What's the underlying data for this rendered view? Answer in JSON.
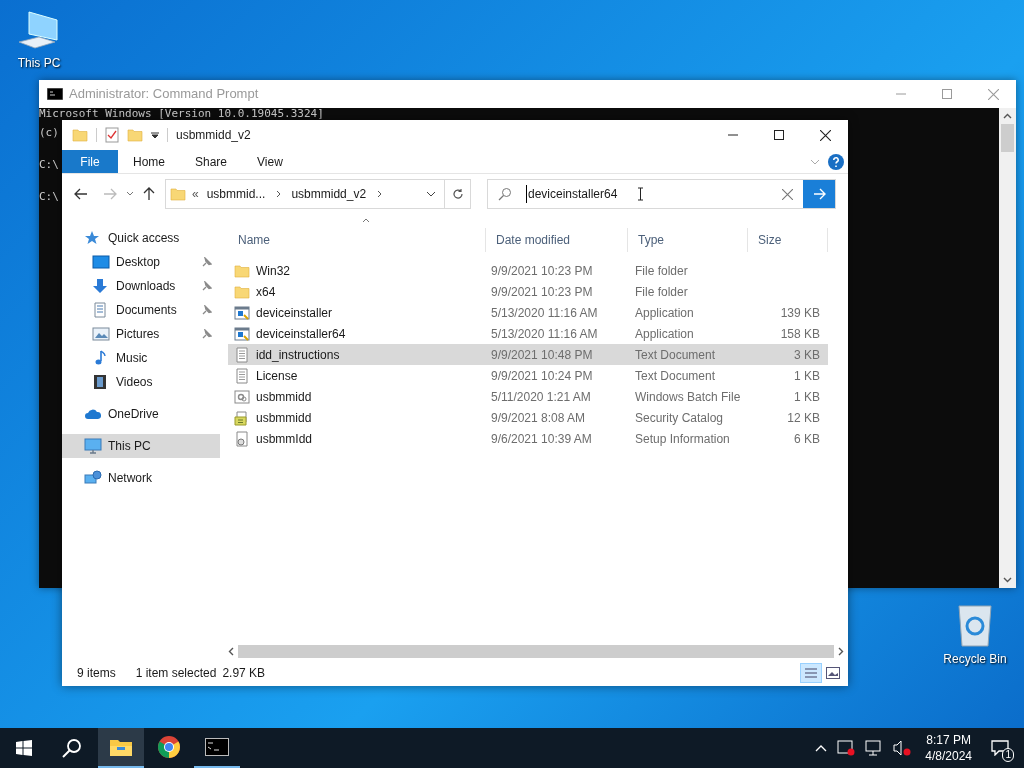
{
  "desktop_icons": [
    {
      "kind": "pc",
      "label": "This PC"
    },
    {
      "kind": "recycle",
      "label": "Recycle Bin"
    }
  ],
  "cmd_window": {
    "title": "Administrator: Command Prompt",
    "lines": [
      "Microsoft Windows [Version 10.0.19045.3324]",
      "(c)",
      "C:\\",
      "C:\\"
    ]
  },
  "explorer": {
    "title": "usbmmidd_v2",
    "ribbon_tabs": [
      {
        "label": "File",
        "selected": true
      },
      {
        "label": "Home",
        "selected": false
      },
      {
        "label": "Share",
        "selected": false
      },
      {
        "label": "View",
        "selected": false
      }
    ],
    "address": {
      "overflow": "«",
      "crumbs": [
        "usbmmid...",
        "usbmmidd_v2"
      ]
    },
    "search": {
      "value": "deviceinstaller64"
    },
    "nav": [
      {
        "kind": "star",
        "label": "Quick access",
        "selected": false,
        "children": [
          {
            "kind": "desktop",
            "label": "Desktop",
            "pinned": true,
            "selected": false
          },
          {
            "kind": "downloads",
            "label": "Downloads",
            "pinned": true,
            "selected": false
          },
          {
            "kind": "documents",
            "label": "Documents",
            "pinned": true,
            "selected": false
          },
          {
            "kind": "pictures",
            "label": "Pictures",
            "pinned": true,
            "selected": false
          },
          {
            "kind": "music",
            "label": "Music",
            "pinned": false,
            "selected": false
          },
          {
            "kind": "videos",
            "label": "Videos",
            "pinned": false,
            "selected": false
          }
        ]
      },
      {
        "kind": "onedrive",
        "label": "OneDrive",
        "selected": false
      },
      {
        "kind": "pc",
        "label": "This PC",
        "selected": true
      },
      {
        "kind": "network",
        "label": "Network",
        "selected": false
      }
    ],
    "columns": [
      "Name",
      "Date modified",
      "Type",
      "Size"
    ],
    "rows": [
      {
        "kind": "folder",
        "name": "Win32",
        "date": "9/9/2021 10:23 PM",
        "type": "File folder",
        "selected": false
      },
      {
        "kind": "folder",
        "name": "x64",
        "date": "9/9/2021 10:23 PM",
        "type": "File folder",
        "selected": false
      },
      {
        "kind": "app",
        "name": "deviceinstaller",
        "date": "5/13/2020 11:16 AM",
        "type": "Application",
        "size": "139 KB",
        "selected": false
      },
      {
        "kind": "app",
        "name": "deviceinstaller64",
        "date": "5/13/2020 11:16 AM",
        "type": "Application",
        "size": "158 KB",
        "selected": false
      },
      {
        "kind": "text",
        "name": "idd_instructions",
        "date": "9/9/2021 10:48 PM",
        "type": "Text Document",
        "size": "3 KB",
        "selected": true
      },
      {
        "kind": "text",
        "name": "License",
        "date": "9/9/2021 10:24 PM",
        "type": "Text Document",
        "size": "1 KB",
        "selected": false
      },
      {
        "kind": "batch",
        "name": "usbmmidd",
        "date": "5/11/2020 1:21 AM",
        "type": "Windows Batch File",
        "size": "1 KB",
        "selected": false
      },
      {
        "kind": "catalog",
        "name": "usbmmidd",
        "date": "9/9/2021 8:08 AM",
        "type": "Security Catalog",
        "size": "12 KB",
        "selected": false
      },
      {
        "kind": "setup",
        "name": "usbmmIdd",
        "date": "9/6/2021 10:39 AM",
        "type": "Setup Information",
        "size": "6 KB",
        "selected": false
      }
    ],
    "status": {
      "count": "9 items",
      "selection": "1 item selected",
      "size": "2.97 KB"
    }
  },
  "taskbar": {
    "apps": [
      {
        "kind": "explorer",
        "selected": true,
        "running": true
      },
      {
        "kind": "chrome",
        "selected": false,
        "running": false
      },
      {
        "kind": "cmd",
        "selected": false,
        "running": true
      }
    ],
    "time": "8:17 PM",
    "date": "4/8/2024",
    "notifications": "1"
  }
}
